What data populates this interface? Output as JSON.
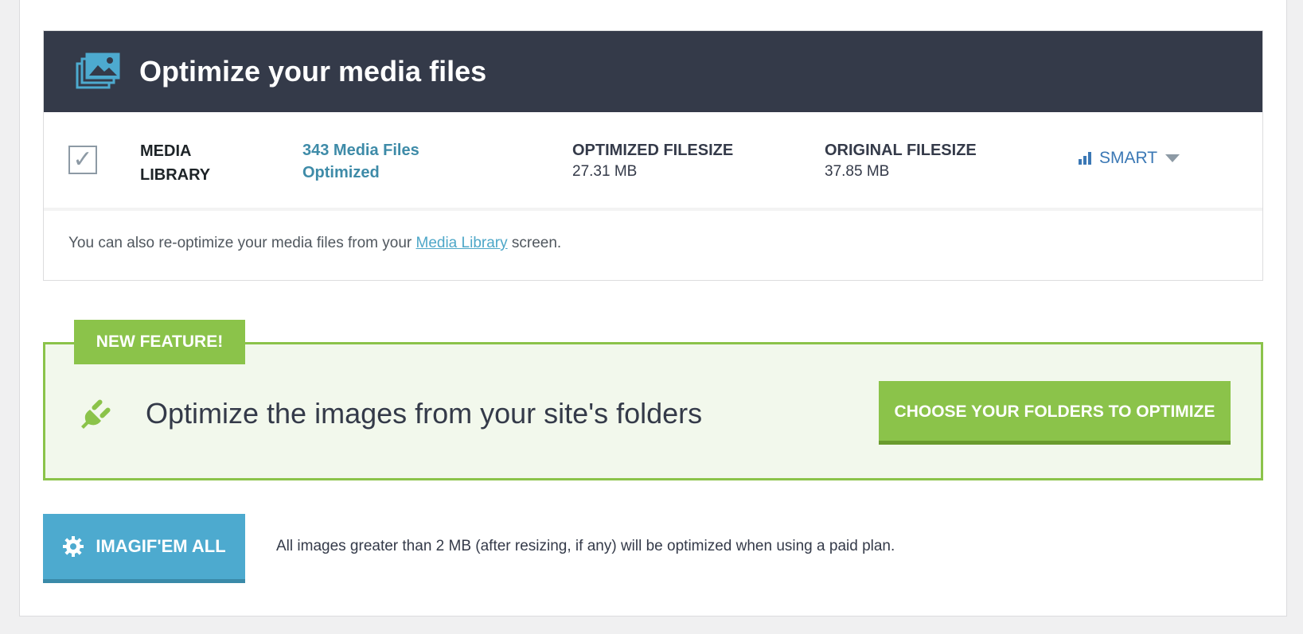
{
  "media": {
    "title": "Optimize your media files",
    "library_label": "MEDIA\nLIBRARY",
    "files_optimized_link": "343 Media Files Optimized",
    "optimized_filesize": {
      "label": "OPTIMIZED FILESIZE",
      "value": "27.31 MB"
    },
    "original_filesize": {
      "label": "ORIGINAL FILESIZE",
      "value": "37.85 MB"
    },
    "level_select": "SMART",
    "note_before": "You can also re-optimize your media files from your ",
    "note_link": "Media Library",
    "note_after": " screen."
  },
  "feature": {
    "badge": "NEW FEATURE!",
    "title": "Optimize the images from your site's folders",
    "button": "CHOOSE YOUR FOLDERS TO OPTIMIZE"
  },
  "bulk": {
    "button": "IMAGIF'EM ALL",
    "note": "All images greater than 2 MB (after resizing, if any) will be optimized when using a paid plan."
  },
  "icons": {
    "header": "images-stack-icon",
    "checkbox": "checkmark-icon",
    "smart": "signal-bars-icon",
    "feature": "plug-icon",
    "bulk": "gear-icon"
  },
  "colors": {
    "header_bg": "#343a49",
    "green": "#8bc34a",
    "blue": "#4daacf",
    "link": "#3e8ba8"
  }
}
